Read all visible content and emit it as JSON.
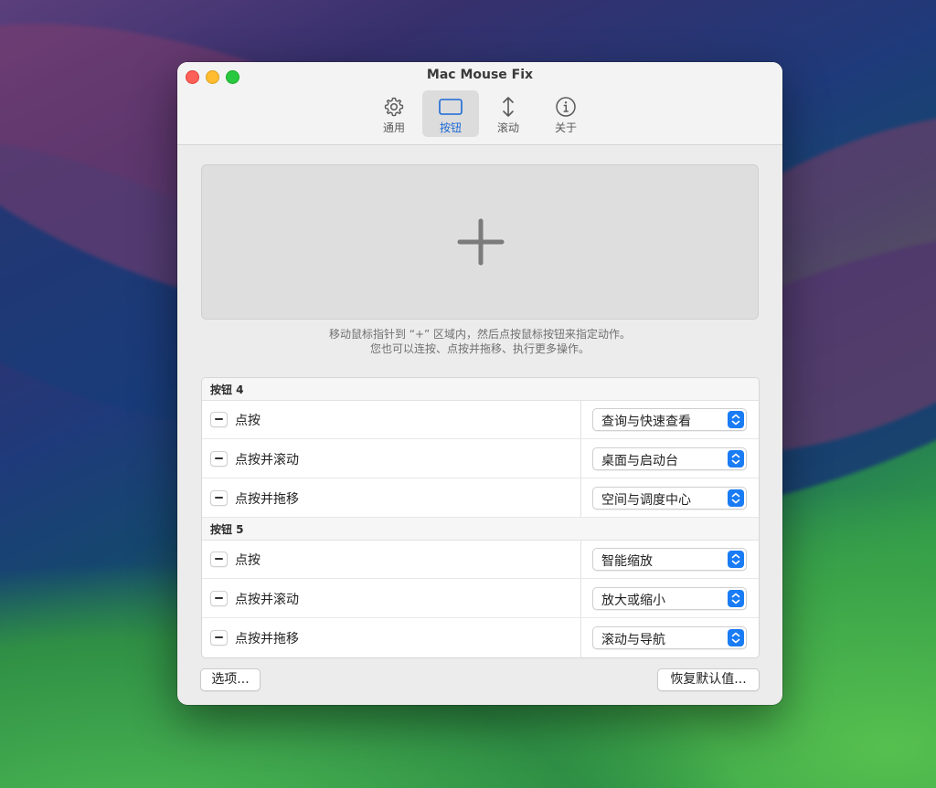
{
  "window": {
    "title": "Mac Mouse Fix"
  },
  "tabs": [
    {
      "label": "通用",
      "icon": "gear-icon"
    },
    {
      "label": "按钮",
      "icon": "mouse-button-icon",
      "selected": true
    },
    {
      "label": "滚动",
      "icon": "scroll-arrows-icon"
    },
    {
      "label": "关于",
      "icon": "info-icon"
    }
  ],
  "drop_area": {
    "icon": "plus-icon",
    "hint_line1": "移动鼠标指针到 “+” 区域内，然后点按鼠标按钮来指定动作。",
    "hint_line2": "您也可以连按、点按并拖移、执行更多操作。"
  },
  "groups": [
    {
      "label": "按钮 4",
      "rows": [
        {
          "trigger": "点按",
          "action": "查询与快速查看"
        },
        {
          "trigger": "点按并滚动",
          "action": "桌面与启动台"
        },
        {
          "trigger": "点按并拖移",
          "action": "空间与调度中心"
        }
      ]
    },
    {
      "label": "按钮 5",
      "rows": [
        {
          "trigger": "点按",
          "action": "智能缩放"
        },
        {
          "trigger": "点按并滚动",
          "action": "放大或缩小"
        },
        {
          "trigger": "点按并拖移",
          "action": "滚动与导航"
        }
      ]
    }
  ],
  "buttons": {
    "options": "选项...",
    "restore_defaults": "恢复默认值..."
  },
  "colors": {
    "accent": "#1a7cf5",
    "close": "#fe5f57",
    "minimize": "#febc2e",
    "maximize": "#28c840"
  }
}
